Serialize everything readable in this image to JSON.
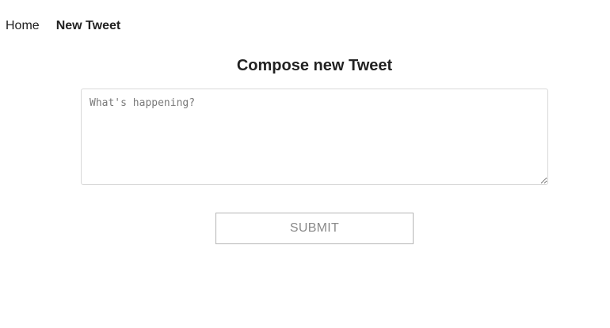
{
  "nav": {
    "home_label": "Home",
    "new_tweet_label": "New Tweet",
    "active_item": "New Tweet"
  },
  "compose": {
    "title": "Compose new Tweet",
    "placeholder": "What's happening?",
    "value": ""
  },
  "form": {
    "submit_label": "SUBMIT"
  },
  "colors": {
    "text": "#222222",
    "placeholder": "#7a7a7a",
    "border": "#d9d9d9",
    "button_border": "#b5b5b5",
    "button_text": "#8a8a8a",
    "background": "#ffffff"
  }
}
